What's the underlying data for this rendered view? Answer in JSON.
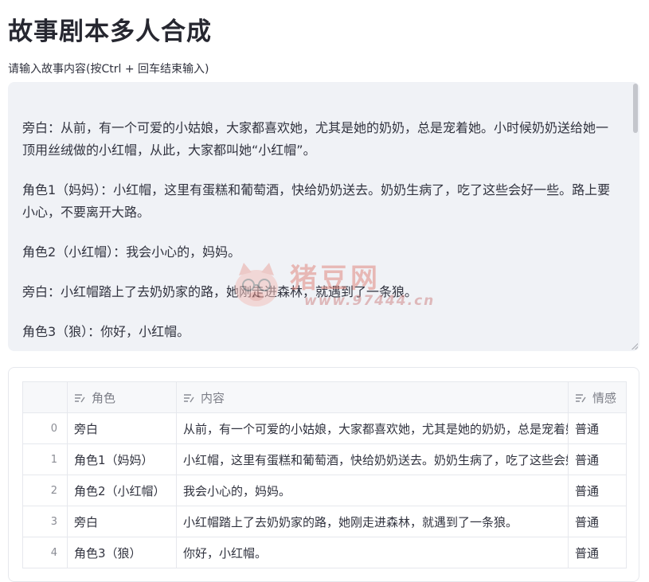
{
  "page": {
    "title": "故事剧本多人合成",
    "input_label": "请输入故事内容(按Ctrl + 回车结束输入)"
  },
  "story_input": {
    "lines": [
      "旁白：从前，有一个可爱的小姑娘，大家都喜欢她，尤其是她的奶奶，总是宠着她。小时候奶奶送给她一顶用丝绒做的小红帽，从此，大家都叫她“小红帽”。",
      "角色1（妈妈）：小红帽，这里有蛋糕和葡萄酒，快给奶奶送去。奶奶生病了，吃了这些会好一些。路上要小心，不要离开大路。",
      "角色2（小红帽）：我会小心的，妈妈。",
      "旁白：小红帽踏上了去奶奶家的路，她刚走进森林，就遇到了一条狼。",
      "角色3（狼）：你好，小红帽。"
    ]
  },
  "watermark": {
    "text": "猪豆网",
    "url": "www.97444.cn"
  },
  "table": {
    "columns": [
      {
        "label": "角色",
        "icon": "text-column-icon"
      },
      {
        "label": "内容",
        "icon": "text-column-icon"
      },
      {
        "label": "情感",
        "icon": "text-column-icon"
      }
    ],
    "rows": [
      {
        "index": "0",
        "role": "旁白",
        "content": "从前，有一个可爱的小姑娘，大家都喜欢她，尤其是她的奶奶，总是宠着她。",
        "emotion": "普通"
      },
      {
        "index": "1",
        "role": "角色1（妈妈）",
        "content": "小红帽，这里有蛋糕和葡萄酒，快给奶奶送去。奶奶生病了，吃了这些会好一些。",
        "emotion": "普通"
      },
      {
        "index": "2",
        "role": "角色2（小红帽）",
        "content": "我会小心的，妈妈。",
        "emotion": "普通"
      },
      {
        "index": "3",
        "role": "旁白",
        "content": "小红帽踏上了去奶奶家的路，她刚走进森林，就遇到了一条狼。",
        "emotion": "普通"
      },
      {
        "index": "4",
        "role": "角色3（狼）",
        "content": "你好，小红帽。",
        "emotion": "普通"
      }
    ]
  },
  "colors": {
    "textarea_bg": "#f0f2f6",
    "header_bg": "#f7f8fa",
    "border": "#e6e8ed",
    "watermark": "#e08a80"
  }
}
